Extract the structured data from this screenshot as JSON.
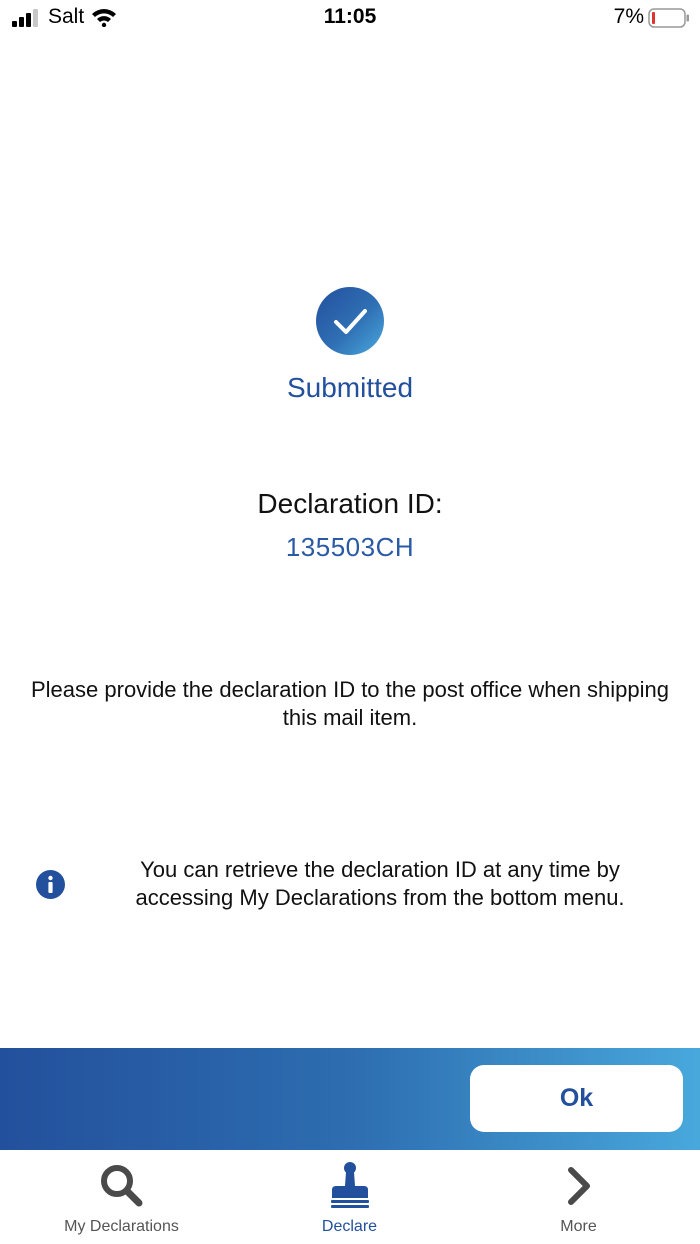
{
  "status_bar": {
    "carrier": "Salt",
    "time": "11:05",
    "battery_percent": "7%",
    "icons": [
      "signal-icon",
      "wifi-icon",
      "battery-icon"
    ]
  },
  "confirmation": {
    "icon": "check-circle-icon",
    "status": "Submitted",
    "declaration_label": "Declaration ID:",
    "declaration_id": "135503CH",
    "instruction": "Please provide the declaration ID to the post office when shipping this mail item."
  },
  "info": {
    "icon": "info-icon",
    "text": "You can retrieve the declaration ID at any time by accessing My Declarations from the bottom menu."
  },
  "action": {
    "ok_label": "Ok"
  },
  "tab_bar": {
    "items": [
      {
        "label": "My Declarations",
        "icon": "search-icon",
        "active": false
      },
      {
        "label": "Declare",
        "icon": "stamp-icon",
        "active": true
      },
      {
        "label": "More",
        "icon": "chevron-right-icon",
        "active": false
      }
    ]
  },
  "colors": {
    "brand_blue": "#23509c",
    "link_blue": "#2a5aa6",
    "gradient_end": "#48a8dc",
    "inactive_icon": "#555555",
    "battery_low": "#e0332f"
  }
}
